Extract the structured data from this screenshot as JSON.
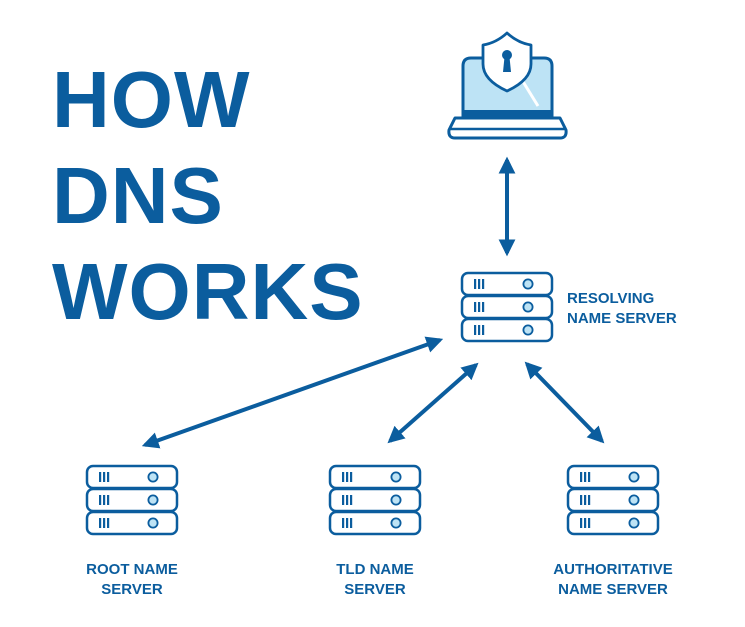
{
  "title": {
    "lines": [
      "HOW",
      "DNS",
      "WORKS"
    ]
  },
  "colors": {
    "primary": "#0b5d9e",
    "light": "#bde3f5",
    "background": "#ffffff"
  },
  "nodes": {
    "client": {
      "icon": "laptop-with-shield-lock-icon"
    },
    "resolver": {
      "icon": "server-stack-icon",
      "label_lines": [
        "RESOLVING",
        "NAME SERVER"
      ]
    },
    "root": {
      "icon": "server-stack-icon",
      "label_lines": [
        "ROOT NAME",
        "SERVER"
      ]
    },
    "tld": {
      "icon": "server-stack-icon",
      "label_lines": [
        "TLD NAME",
        "SERVER"
      ]
    },
    "authoritative": {
      "icon": "server-stack-icon",
      "label_lines": [
        "AUTHORITATIVE",
        "NAME SERVER"
      ]
    }
  },
  "connections": [
    {
      "from": "client",
      "to": "resolver",
      "type": "bidirectional"
    },
    {
      "from": "resolver",
      "to": "root",
      "type": "bidirectional"
    },
    {
      "from": "resolver",
      "to": "tld",
      "type": "bidirectional"
    },
    {
      "from": "resolver",
      "to": "authoritative",
      "type": "bidirectional"
    }
  ]
}
